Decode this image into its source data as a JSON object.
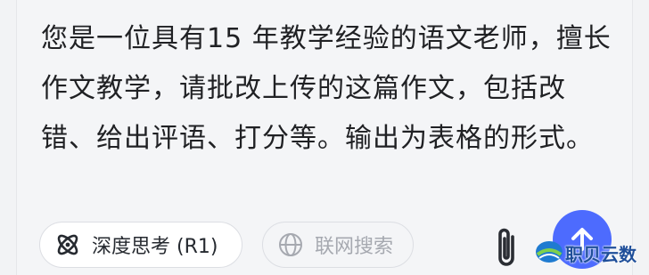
{
  "prompt": {
    "text": "您是一位具有15 年教学经验的语文老师，擅长作文教学，请批改上传的这篇作文，包括改错、给出评语、打分等。输出为表格的形式。"
  },
  "toolbar": {
    "deep_think_label": "深度思考 (R1)",
    "web_search_label": "联网搜索"
  },
  "colors": {
    "accent": "#4d6bfe",
    "text": "#202124",
    "disabled_text": "#a6a9b0"
  },
  "icons": {
    "deep_think": "atom-icon",
    "web_search": "globe-icon",
    "attach": "paperclip-icon",
    "send": "arrow-up-icon"
  },
  "watermark": {
    "brand": "职贝云数"
  }
}
